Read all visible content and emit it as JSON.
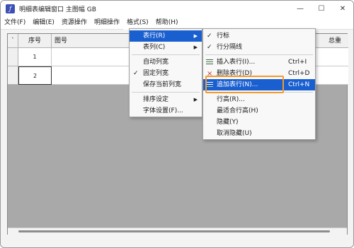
{
  "window": {
    "title": "明细表编辑窗口 主图幅 GB",
    "icon_name": "app-logo-icon",
    "controls": {
      "minimize": "—",
      "maximize": "☐",
      "close": "✕"
    }
  },
  "menubar": [
    {
      "label": "文件(F)"
    },
    {
      "label": "编辑(E)"
    },
    {
      "label": "资源操作"
    },
    {
      "label": "明细操作"
    },
    {
      "label": "格式(S)"
    },
    {
      "label": "帮助(H)"
    }
  ],
  "table": {
    "corner": "`",
    "headers": [
      "序号",
      "图号",
      "总重"
    ],
    "rows": [
      {
        "index": "1"
      },
      {
        "index": "2"
      }
    ]
  },
  "format_menu": {
    "items": [
      {
        "label": "表行(R)",
        "submenu": true,
        "highlighted": true
      },
      {
        "label": "表列(C)",
        "submenu": true
      },
      {
        "label": "自动列宽"
      },
      {
        "label": "固定列宽",
        "checked": true
      },
      {
        "label": "保存当前列宽"
      },
      {
        "label": "排序设定",
        "submenu": true
      },
      {
        "label": "字体设置(F)..."
      }
    ]
  },
  "row_submenu": {
    "items": [
      {
        "label": "行标",
        "checked": true
      },
      {
        "label": "行分隔线",
        "checked": true
      },
      {
        "label": "插入表行(I)...",
        "shortcut": "Ctrl+I",
        "icon": "insert-row-icon"
      },
      {
        "label": "删除表行(D)",
        "shortcut": "Ctrl+D",
        "icon": "delete-row-icon"
      },
      {
        "label": "追加表行(N)...",
        "shortcut": "Ctrl+N",
        "icon": "append-row-icon",
        "highlighted": true
      },
      {
        "label": "行高(R)..."
      },
      {
        "label": "最适合行高(H)"
      },
      {
        "label": "隐藏(Y)"
      },
      {
        "label": "取消隐藏(U)"
      }
    ]
  },
  "colors": {
    "highlight": "#1a5fd0",
    "annotation": "#f39a2b",
    "grid_background": "#a9a9a9"
  }
}
